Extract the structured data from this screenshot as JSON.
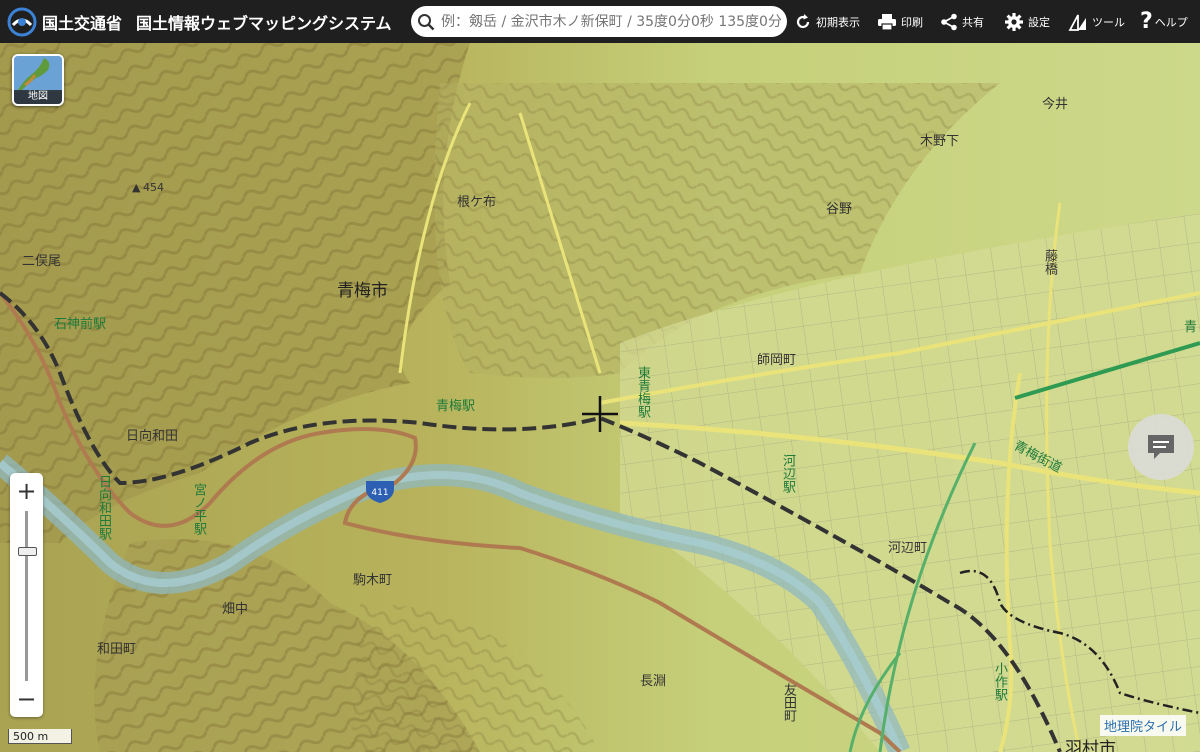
{
  "header": {
    "ministry": "国土交通省",
    "system_name": "国土情報ウェブマッピングシステム",
    "search_placeholder": "例：剱岳 / 金沢市木ノ新保町 / 35度0分0秒 135度0分0秒",
    "buttons": {
      "reset": "初期表示",
      "print": "印刷",
      "share": "共有",
      "settings": "設定",
      "tools": "ツール",
      "help": "ヘルプ"
    }
  },
  "map": {
    "layer_button_label": "地図",
    "scale_label": "500 m",
    "attribution": "地理院タイル",
    "route_number": "411",
    "spot_height": "454",
    "labels": {
      "ome_city": "青梅市",
      "hamura_city": "羽村市",
      "nenegaso": "根ケ布",
      "futamatao": "二俣尾",
      "hinatawada": "日向和田",
      "hinatawada_station": "日向和田駅",
      "ishigamimae_station": "石神前駅",
      "ome_station": "青梅駅",
      "higashiome_station": "東青梅駅",
      "miyanohira_station": "宮ノ平駅",
      "kabe_station": "河辺駅",
      "ozaku_station": "小作駅",
      "kabecho": "河辺町",
      "morooka": "師岡町",
      "yano": "谷野",
      "kinoshita": "木野下",
      "imai": "今井",
      "fujihashi": "藤橋",
      "komagicho": "駒木町",
      "hatanaka": "畑中",
      "wadamachi": "和田町",
      "nagabuchi": "長淵",
      "tomoda": "友田町",
      "ome_kaido": "青梅街道",
      "edge_label": "青"
    }
  },
  "colors": {
    "header_bg": "#1f1f1f",
    "water": "#8fb8c0",
    "road_primary": "#c89660",
    "rail": "#333333",
    "label_green": "#1f7a3a"
  }
}
